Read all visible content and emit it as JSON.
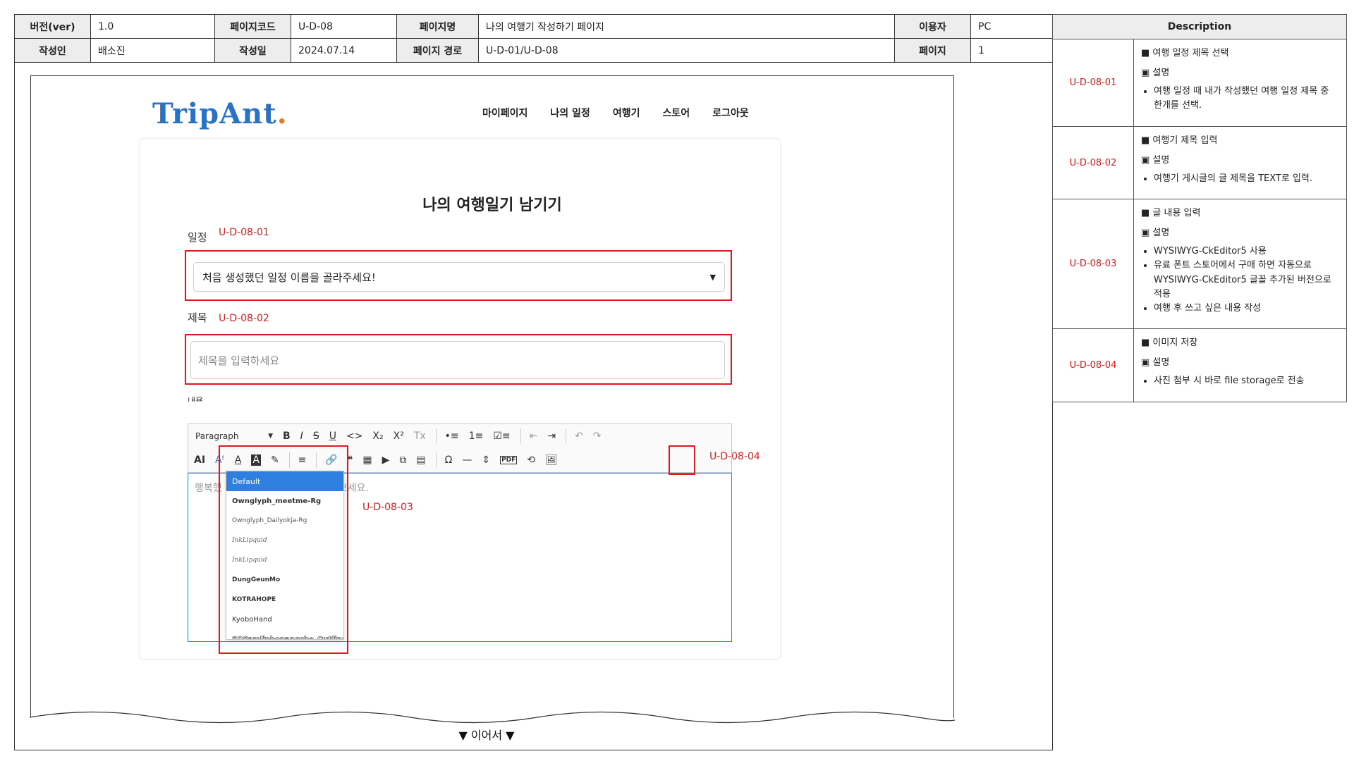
{
  "meta": {
    "version_label": "버전(ver)",
    "version_value": "1.0",
    "page_code_label": "페이지코드",
    "page_code_value": "U-D-08",
    "page_name_label": "페이지명",
    "page_name_value": "나의 여행기 작성하기 페이지",
    "user_label": "이용자",
    "user_value": "PC",
    "author_label": "작성인",
    "author_value": "배소진",
    "date_label": "작성일",
    "date_value": "2024.07.14",
    "path_label": "페이지 경로",
    "path_value": "U-D-01/U-D-08",
    "page_label": "페이지",
    "page_value": "1"
  },
  "site": {
    "logo_main": "TripAnt",
    "logo_dot": ".",
    "nav": [
      "마이페이지",
      "나의 일정",
      "여행기",
      "스토어",
      "로그아웃"
    ]
  },
  "form": {
    "heading": "나의 여행일기 남기기",
    "schedule_label": "일정",
    "schedule_select": "처음 생성했던 일정 이름을 골라주세요!",
    "title_label": "제목",
    "title_placeholder": "제목을 입력하세요",
    "content_label": "내용",
    "editor_placeholder_left": "행복했",
    "editor_placeholder_right": "겨보세요."
  },
  "toolbar": {
    "row1": [
      "Paragraph",
      "B",
      "I",
      "S",
      "U",
      "<>",
      "X₂",
      "X²",
      "Tx",
      "•≡",
      "1≡",
      "☑≡",
      "⇤",
      "⇥",
      "↶",
      "↷"
    ],
    "row2": [
      "AI",
      "Aᶠ",
      "A",
      "A",
      "✎",
      "≡",
      "🔗",
      "❝",
      "▦",
      "▶",
      "⧉",
      "▤",
      "Ω",
      "—",
      "⇕",
      "PDF",
      "⟲",
      "🖼"
    ]
  },
  "font_dropdown": {
    "options": [
      "Default",
      "Ownglyph_meetme-Rg",
      "Ownglyph_Dailyokja-Rg",
      "InkLipquid",
      "InkLipquid",
      "DungGeunMo",
      "KOTRAHOPE",
      "KyoboHand",
      "SDSamliphopangche_Outline"
    ]
  },
  "annotations": {
    "a1": "U-D-08-01",
    "a2": "U-D-08-02",
    "a3": "U-D-08-03",
    "a4": "U-D-08-04"
  },
  "description": {
    "header": "Description",
    "rows": [
      {
        "id": "U-D-08-01",
        "title": "■ 여행 일정 제목 선택",
        "sub": "▣ 설명",
        "bullets": [
          "여행 일정 때 내가 작성했던 여행 일정 제목 중 한개를 선택."
        ]
      },
      {
        "id": "U-D-08-02",
        "title": "■ 여행기 제목 입력",
        "sub": "▣ 설명",
        "bullets": [
          "여행기 게시글의 글 제목을 TEXT로 입력."
        ]
      },
      {
        "id": "U-D-08-03",
        "title": "■ 글 내용 입력",
        "sub": "▣ 설명",
        "bullets": [
          "WYSIWYG-CkEditor5 사용",
          "유료 폰트 스토어에서 구매 하면 자동으로 WYSIWYG-CkEditor5 글꼴 추가된 버전으로 적용",
          "여행 후 쓰고 싶은 내용 작성"
        ]
      },
      {
        "id": "U-D-08-04",
        "title": "■ 이미지 저장",
        "sub": "▣ 설명",
        "bullets": [
          "사진 첨부 시 바로 file storage로 전송"
        ]
      }
    ]
  },
  "footer": {
    "continue": "▼ 이어서 ▼"
  }
}
